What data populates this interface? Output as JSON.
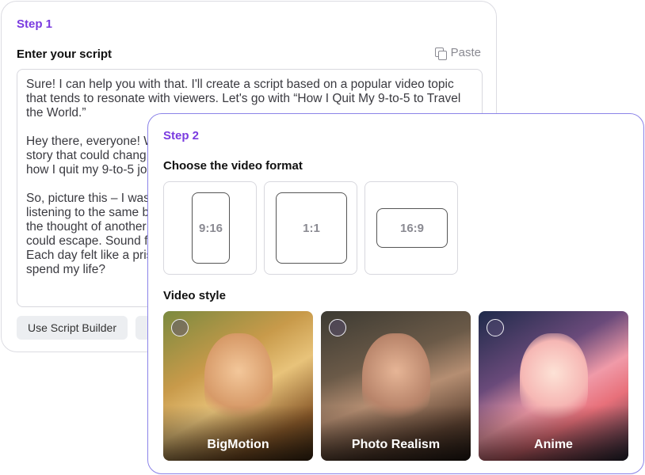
{
  "step1": {
    "step_label": "Step 1",
    "title": "Enter your script",
    "paste_label": "Paste",
    "paste_icon": "copy-icon",
    "script_text": "Sure! I can help you with that. I'll create a script based on a popular video topic that tends to resonate with viewers. Let's go with “How I Quit My 9-to-5 to Travel the World.”\n\nHey there, everyone! W\nstory that could chang\nhow I quit my 9-to-5 jo\n\nSo, picture this – I was\nlistening to the same b\nthe thought of another\ncould escape. Sound f\nEach day felt like a pris\nspend my life?",
    "buttons": [
      "Use Script Builder",
      ""
    ]
  },
  "step2": {
    "step_label": "Step 2",
    "format_title": "Choose the video format",
    "formats": [
      "9:16",
      "1:1",
      "16:9"
    ],
    "style_title": "Video style",
    "styles": [
      "BigMotion",
      "Photo Realism",
      "Anime"
    ]
  },
  "colors": {
    "accent": "#7a3be0",
    "active_border": "#8b83e8"
  }
}
